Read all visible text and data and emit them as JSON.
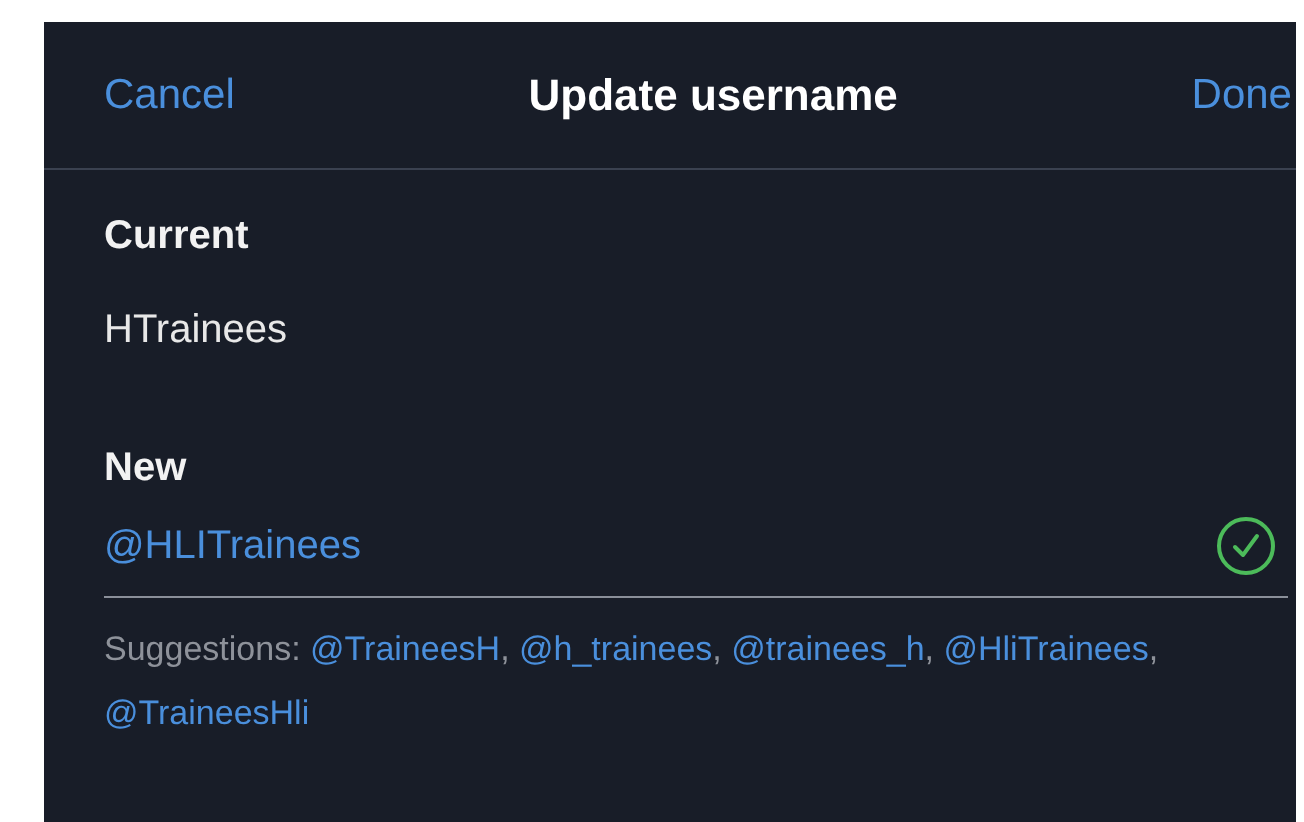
{
  "header": {
    "cancel": "Cancel",
    "title": "Update username",
    "done": "Done"
  },
  "current": {
    "label": "Current",
    "value": "HTrainees"
  },
  "new": {
    "label": "New",
    "value": "@HLITrainees",
    "valid": true
  },
  "suggestions": {
    "label": "Suggestions:",
    "separator": ",",
    "items": [
      "@TraineesH",
      "@h_trainees",
      "@trainees_h",
      "@HliTrainees",
      "@TraineesHli"
    ]
  }
}
